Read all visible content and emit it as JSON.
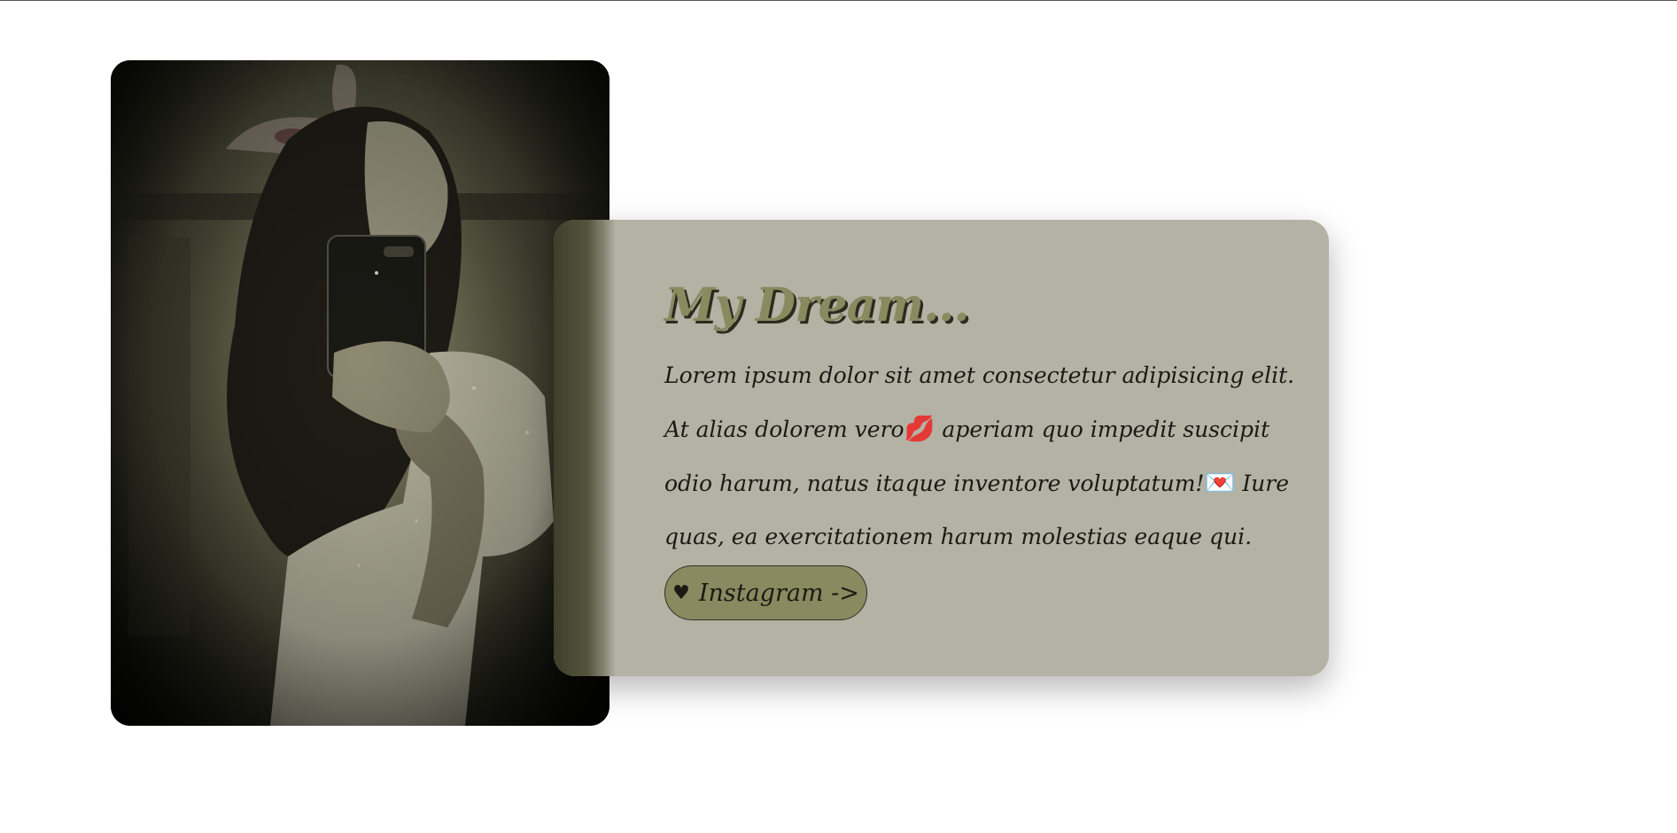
{
  "colors": {
    "card_background": "#b3b2a5",
    "accent_olive": "#8a8a61",
    "text_dark": "#1a1a14",
    "photo_sepia": "#6b6b52"
  },
  "photo": {
    "icon": "portrait-photo"
  },
  "card": {
    "title": "My Dream...",
    "body_part1": "Lorem ipsum dolor sit amet consectetur adipisicing elit. At alias dolorem vero",
    "emoji1": "💋",
    "body_part2": " aperiam quo impedit suscipit odio harum, natus itaque inventore voluptatum!",
    "emoji2": "💌",
    "body_part3": " Iure quas, ea exercitationem harum molestias eaque qui.",
    "button": {
      "icon_glyph": "♥",
      "icon_name": "heart-icon",
      "label": "Instagram ->"
    }
  }
}
